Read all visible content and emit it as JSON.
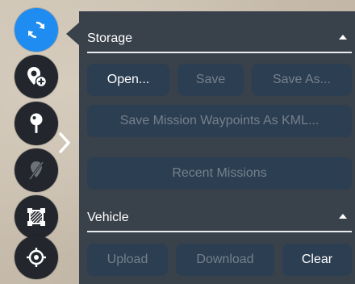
{
  "toolstrip": {
    "tools": [
      {
        "icon": "sync-icon",
        "active": true
      },
      {
        "icon": "add-waypoint-icon",
        "active": false
      },
      {
        "icon": "pin-icon",
        "active": false
      },
      {
        "icon": "pattern-icon",
        "active": false
      },
      {
        "icon": "polygon-icon",
        "active": false
      },
      {
        "icon": "center-target-icon",
        "active": false
      }
    ],
    "expand_icon": "chevron-right-icon"
  },
  "panel": {
    "storage": {
      "title": "Storage",
      "open_label": "Open...",
      "save_label": "Save",
      "save_as_label": "Save As...",
      "save_kml_label": "Save Mission Waypoints As KML...",
      "recent_label": "Recent Missions"
    },
    "vehicle": {
      "title": "Vehicle",
      "upload_label": "Upload",
      "download_label": "Download",
      "clear_label": "Clear"
    }
  },
  "colors": {
    "panel_bg": "#39414b",
    "button_bg": "#2c3e52",
    "active_tool": "#1e8cf0",
    "tool_bg": "#23272d",
    "disabled_text": "#75808c"
  }
}
